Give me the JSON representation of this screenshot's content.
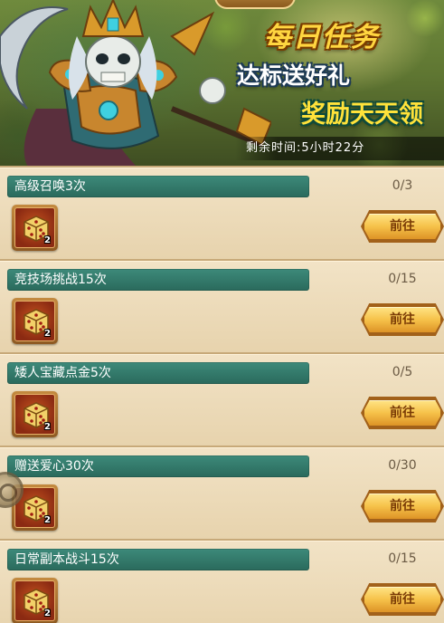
{
  "banner": {
    "title": "每日任务",
    "slogan_line1": "达标送好礼",
    "slogan_line2": "奖励天天领",
    "countdown": "剩余时间:5小时22分"
  },
  "tasks": [
    {
      "name": "高级召唤3次",
      "progress": "0/3",
      "reward_icon": "dice-icon",
      "reward_count": "2",
      "button": "前往"
    },
    {
      "name": "竞技场挑战15次",
      "progress": "0/15",
      "reward_icon": "dice-icon",
      "reward_count": "2",
      "button": "前往"
    },
    {
      "name": "矮人宝藏点金5次",
      "progress": "0/5",
      "reward_icon": "dice-icon",
      "reward_count": "2",
      "button": "前往"
    },
    {
      "name": "赠送爱心30次",
      "progress": "0/30",
      "reward_icon": "dice-icon",
      "reward_count": "2",
      "button": "前往"
    },
    {
      "name": "日常副本战斗15次",
      "progress": "0/15",
      "reward_icon": "dice-icon",
      "reward_count": "2",
      "button": "前往"
    }
  ],
  "colors": {
    "task_name_bg": "#2f7566",
    "button_gold": "#f6c24a",
    "title_gold": "#ffd640"
  }
}
